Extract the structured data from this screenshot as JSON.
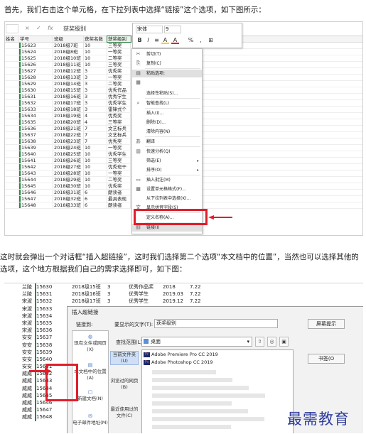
{
  "paragraph1": "首先，我们右击这个单元格，在下拉列表中选择“链接”这个选项，如下图所示：",
  "paragraph2": "这时就会弹出一个对话框“插入超链接”，这时我们选择第二个选项“本文档中的位置”，当然也可以选择其他的选项，这个地方根据我们自己的需求选择即可，如下图：",
  "watermark": "最需教育",
  "colors": {
    "accent_red": "#e01e2a",
    "excel_green": "#1f8a3d"
  },
  "shot1": {
    "formula_bar": {
      "cancel": "×",
      "confirm": "✓",
      "fx": "fx",
      "value": "获奖级别"
    },
    "headers": [
      "姓名",
      "学号",
      "班级",
      "获奖名数",
      "获奖级别"
    ],
    "rows": [
      [
        "",
        "15623",
        "2018级7班",
        "10",
        "三等奖"
      ],
      [
        "",
        "15624",
        "2018级8班",
        "10",
        "一等奖"
      ],
      [
        "",
        "15625",
        "2018级10班",
        "10",
        "二等奖"
      ],
      [
        "",
        "15626",
        "2018级11班",
        "10",
        "三等奖"
      ],
      [
        "",
        "15627",
        "2018级12班",
        "3",
        "优秀奖"
      ],
      [
        "",
        "15628",
        "2018级13班",
        "3",
        "一等奖"
      ],
      [
        "",
        "15629",
        "2018级14班",
        "3",
        "二等奖"
      ],
      [
        "",
        "15630",
        "2018级15班",
        "3",
        "优秀作品"
      ],
      [
        "",
        "15631",
        "2018级16班",
        "3",
        "优秀学生"
      ],
      [
        "",
        "15632",
        "2018级17班",
        "3",
        "优秀学生"
      ],
      [
        "",
        "15633",
        "2018级18班",
        "3",
        "雷锋式个"
      ],
      [
        "",
        "15634",
        "2018级19班",
        "4",
        "优秀奖"
      ],
      [
        "",
        "15635",
        "2018级20班",
        "4",
        "三等奖"
      ],
      [
        "",
        "15636",
        "2018级21班",
        "7",
        "文艺标兵"
      ],
      [
        "",
        "15637",
        "2018级22班",
        "7",
        "文艺标兵"
      ],
      [
        "",
        "15638",
        "2018级23班",
        "7",
        "优秀奖"
      ],
      [
        "",
        "15639",
        "2018级24班",
        "10",
        "一等奖"
      ],
      [
        "",
        "15640",
        "2018级25班",
        "10",
        "优秀学生"
      ],
      [
        "",
        "15641",
        "2018级26班",
        "10",
        "三等奖"
      ],
      [
        "",
        "15642",
        "2018级27班",
        "10",
        "优秀班干"
      ],
      [
        "",
        "15643",
        "2018级28班",
        "10",
        "一等奖"
      ],
      [
        "",
        "15644",
        "2018级29班",
        "10",
        "二等奖"
      ],
      [
        "",
        "15645",
        "2018级30班",
        "10",
        "优秀奖"
      ],
      [
        "",
        "15646",
        "2018级31班",
        "6",
        "朗读者"
      ],
      [
        "",
        "15647",
        "2018级32班",
        "6",
        "最具表现"
      ],
      [
        "",
        "15648",
        "2018级33班",
        "6",
        "朗读者"
      ]
    ],
    "peek_col_f": {
      "header": "获奖时间",
      "r1": "2019.",
      "last1": "2019.03",
      "last2": "2019.04",
      "g1": "4.55",
      "g2": "4.55"
    },
    "mini_toolbar": {
      "font": "宋体",
      "size": "9",
      "bold": "B",
      "italic": "I",
      "align": "≡",
      "fill": "A",
      "fontcolor": "A",
      "percent": "%",
      "comma": ",",
      "border": "⊞"
    },
    "context_menu": [
      {
        "label": "剪切(T)",
        "icon": "scissors-icon"
      },
      {
        "label": "复制(C)",
        "icon": "copy-icon"
      },
      {
        "label": "粘贴选项:",
        "icon": "paste-icon",
        "hover": true
      },
      {
        "label": "",
        "icon": "paste-clipboard-icon"
      },
      {
        "label": "选择性粘贴(S)...",
        "icon": ""
      },
      {
        "label": "智能查找(L)",
        "icon": "search-icon"
      },
      {
        "label": "插入(I)...",
        "icon": ""
      },
      {
        "label": "删除(D)...",
        "icon": ""
      },
      {
        "label": "清除内容(N)",
        "icon": ""
      },
      {
        "label": "翻译",
        "icon": "translate-icon"
      },
      {
        "label": "快速分析(Q)",
        "icon": "quick-analysis-icon"
      },
      {
        "label": "筛选(E)",
        "icon": "",
        "submenu": true
      },
      {
        "label": "排序(O)",
        "icon": "",
        "submenu": true
      },
      {
        "label": "插入批注(M)",
        "icon": "comment-icon"
      },
      {
        "label": "设置单元格格式(F)...",
        "icon": "format-cells-icon"
      },
      {
        "label": "从下拉列表中选择(K)...",
        "icon": ""
      },
      {
        "label": "显示拼音字段(S)",
        "icon": "pinyin-icon"
      },
      {
        "label": "定义名称(A)...",
        "icon": ""
      },
      {
        "label": "链接(I)",
        "icon": "link-icon",
        "hover": true
      }
    ]
  },
  "shot2": {
    "rows": [
      [
        "兰陵",
        "15630",
        "2018级15班",
        "3",
        "优秀作品奖",
        "2018",
        "7.22"
      ],
      [
        "兰陵",
        "15631",
        "2018级16班",
        "3",
        "优秀学生",
        "2019.03",
        "7.22"
      ],
      [
        "宋淑",
        "15632",
        "2018级17班",
        "3",
        "优秀学生",
        "2019.12",
        "7.22"
      ],
      [
        "宋淑",
        "15633",
        "",
        "",
        "",
        "",
        ""
      ],
      [
        "宋淑",
        "15634",
        "",
        "",
        "",
        "",
        ""
      ],
      [
        "宋淑",
        "15635",
        "",
        "",
        "",
        "",
        ""
      ],
      [
        "宋淑",
        "15636",
        "",
        "",
        "",
        "",
        ""
      ],
      [
        "安安",
        "15637",
        "",
        "",
        "",
        "",
        ""
      ],
      [
        "安安",
        "15638",
        "",
        "",
        "",
        "",
        ""
      ],
      [
        "安安",
        "15639",
        "",
        "",
        "",
        "",
        ""
      ],
      [
        "安安",
        "15640",
        "",
        "",
        "",
        "",
        ""
      ],
      [
        "安安",
        "15641",
        "",
        "",
        "",
        "",
        ""
      ],
      [
        "威威",
        "15642",
        "",
        "",
        "",
        "",
        ""
      ],
      [
        "威威",
        "15643",
        "",
        "",
        "",
        "",
        ""
      ],
      [
        "威威",
        "15644",
        "",
        "",
        "",
        "",
        ""
      ],
      [
        "威威",
        "15645",
        "",
        "",
        "",
        "",
        ""
      ],
      [
        "威威",
        "15646",
        "",
        "",
        "",
        "",
        ""
      ],
      [
        "威威",
        "15647",
        "",
        "",
        "",
        "",
        ""
      ],
      [
        "威威",
        "15648",
        "",
        "",
        "",
        "",
        ""
      ]
    ],
    "dialog": {
      "title": "插入超链接",
      "link_to_label": "链接到:",
      "display_text_label": "要显示的文字(T):",
      "display_text_value": "获奖级别",
      "screentip_button": "屏幕提示",
      "look_in_label": "查找范围(L):",
      "look_in_value": "桌面",
      "bookmark_button": "书签(O",
      "link_bar": [
        {
          "label": "现有文件或网页(X)",
          "icon": "globe-icon"
        },
        {
          "label": "本文档中的位置(A)",
          "icon": "document-place-icon"
        },
        {
          "label": "新建文档(N)",
          "icon": "new-document-icon"
        },
        {
          "label": "电子邮件地址(M)",
          "icon": "email-icon"
        }
      ],
      "mid_bar": [
        {
          "label": "当前文件夹(U)",
          "active": true
        },
        {
          "label": "浏览过的网页(B)",
          "active": false
        },
        {
          "label": "最近使用过的文件(C)",
          "active": false
        }
      ],
      "files": [
        {
          "label": "Adobe Premiere Pro CC 2019",
          "badge": "Pr"
        },
        {
          "label": "Adobe Photoshop CC 2019",
          "badge": "Ps"
        }
      ]
    }
  }
}
